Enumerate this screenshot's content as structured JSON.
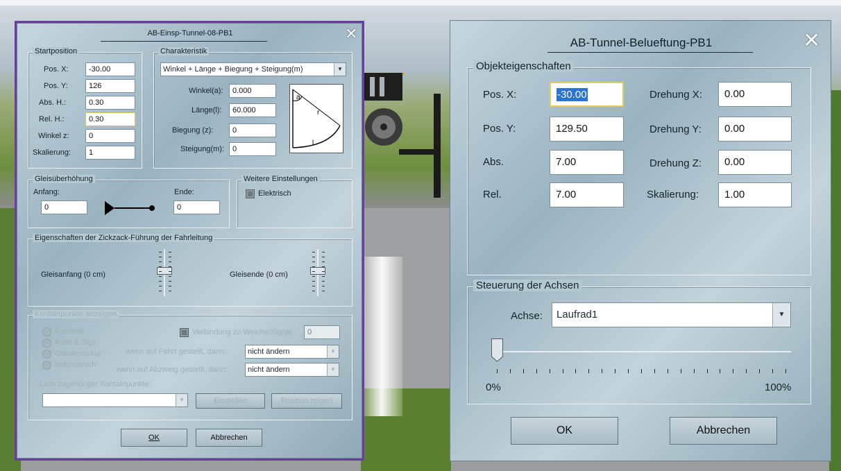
{
  "left_dialog": {
    "title": "AB-Einsp-Tunnel-08-PB1",
    "close_glyph": "✕",
    "start": {
      "legend": "Startposition",
      "pos_x_label": "Pos. X:",
      "pos_x": "-30.00",
      "pos_y_label": "Pos. Y:",
      "pos_y": "126",
      "abs_h_label": "Abs. H.:",
      "abs_h": "0.30",
      "rel_h_label": "Rel. H.:",
      "rel_h": "0.30",
      "winkel_z_label": "Winkel z:",
      "winkel_z": "0",
      "skal_label": "Skalierung:",
      "skal": "1"
    },
    "char": {
      "legend": "Charakteristik",
      "select": "Winkel + Länge + Biegung + Steigung(m)",
      "winkel_label": "Winkel(a):",
      "winkel": "0.000",
      "laenge_label": "Länge(l):",
      "laenge": "60.000",
      "biegung_label": "Biegung (z):",
      "biegung": "0",
      "steigung_label": "Steigung(m):",
      "steigung": "0",
      "diagram_a": "a",
      "diagram_r": "r",
      "diagram_l": "l"
    },
    "ueber": {
      "legend": "Gleisüberhöhung",
      "anfang_label": "Anfang:",
      "anfang": "0",
      "ende_label": "Ende:",
      "ende": "0"
    },
    "weitere": {
      "legend": "Weitere Einstellungen",
      "elektrisch": "Elektrisch"
    },
    "zickzack": {
      "legend": "Eigenschaften der Zickzack-Führung der Fahrleitung",
      "anfang": "Gleisanfang (0 cm)",
      "ende": "Gleisende (0 cm)"
    },
    "kontakt": {
      "legend": "Kontaktpunkte anzeigen",
      "radios": [
        "Kontakte",
        "Rails & Sigs",
        "Gleiskontakte",
        "automatisch"
      ],
      "verbindung": "Verbindung zu Weiche/Signal",
      "verbindung_val": "0",
      "fahrt_label": "wenn auf Fahrt gestellt, dann:",
      "fahrt_val": "nicht ändern",
      "abzweig_label": "wenn auf Abzweig gestellt, dann:",
      "abzweig_val": "nicht ändern",
      "liste_label": "Liste zugehöriger Kontaktpunkte:",
      "einstellen": "Einstellen",
      "position": "Position zeigen"
    },
    "ok": "OK",
    "cancel": "Abbrechen"
  },
  "right_dialog": {
    "title": "AB-Tunnel-Belueftung-PB1",
    "close_glyph": "✕",
    "obj": {
      "legend": "Objekteigenschaften",
      "pos_x_label": "Pos. X:",
      "pos_x": "-30.00",
      "pos_y_label": "Pos. Y:",
      "pos_y": "129.50",
      "abs_label": "Abs.",
      "abs": "7.00",
      "rel_label": "Rel.",
      "rel": "7.00",
      "dreh_x_label": "Drehung X:",
      "dreh_x": "0.00",
      "dreh_y_label": "Drehung Y:",
      "dreh_y": "0.00",
      "dreh_z_label": "Drehung Z:",
      "dreh_z": "0.00",
      "skal_label": "Skalierung:",
      "skal": "1.00"
    },
    "achsen": {
      "legend": "Steuerung der Achsen",
      "achse_label": "Achse:",
      "achse": "Laufrad1",
      "slider_value": 0,
      "min_label": "0%",
      "max_label": "100%"
    },
    "ok": "OK",
    "cancel": "Abbrechen"
  }
}
